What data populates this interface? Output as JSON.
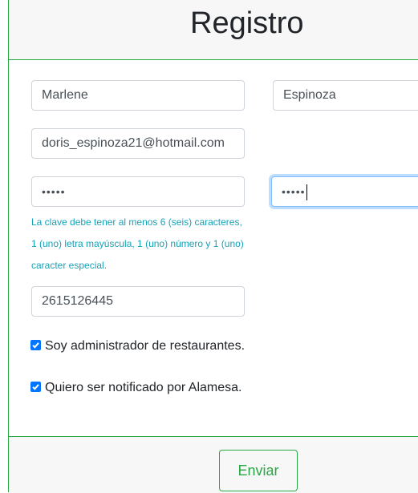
{
  "header": {
    "title": "Registro"
  },
  "form": {
    "first_name": "Marlene",
    "last_name": "Espinoza",
    "email": "doris_espinoza21@hotmail.com",
    "password": "•••••",
    "password_confirm": "•••••",
    "password_help": "La clave debe tener al menos 6 (seis) caracteres, 1 (uno) letra mayúscula, 1 (uno) número y 1 (uno) caracter especial.",
    "phone": "2615126445",
    "check_admin": {
      "label": "Soy administrador de restaurantes.",
      "checked": true
    },
    "check_notify": {
      "label": "Quiero ser notificado por Alamesa.",
      "checked": true
    }
  },
  "footer": {
    "submit_label": "Enviar"
  },
  "colors": {
    "accent": "#28a745",
    "help_text": "#17a2b8",
    "checkbox": "#0075ff"
  }
}
